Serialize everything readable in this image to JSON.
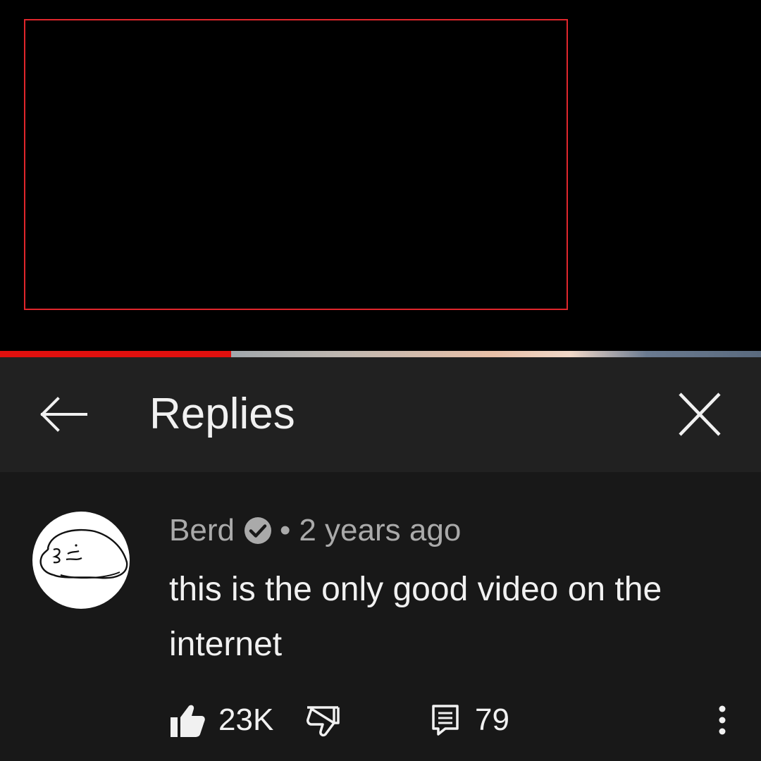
{
  "player": {
    "progress_fraction": 0.304,
    "progress_color": "#e0100e",
    "frame_border_color": "#e0262c"
  },
  "header": {
    "title": "Replies",
    "back_icon": "arrow-left-icon",
    "close_icon": "close-icon"
  },
  "comment": {
    "author": "Berd",
    "verified_icon": "verified-check-icon",
    "separator": "•",
    "timestamp": "2 years ago",
    "text": "this is the only good video on the internet",
    "likes": "23K",
    "replies": "79",
    "like_icon": "thumbs-up-filled-icon",
    "dislike_icon": "thumbs-down-outline-icon",
    "reply_icon": "comment-icon",
    "more_icon": "more-vertical-icon"
  },
  "colors": {
    "header_bg": "#212121",
    "comment_bg": "#181818",
    "text_primary": "#f1f1f1",
    "text_secondary": "#aaaaaa"
  }
}
